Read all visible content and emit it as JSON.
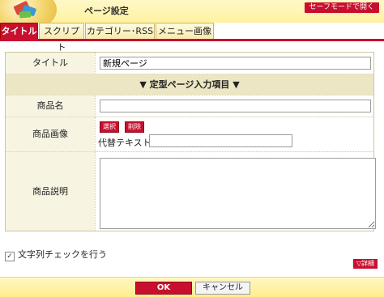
{
  "header": {
    "title": "ページ設定",
    "safe_mode_label": "セーフモードで開く"
  },
  "tabs": [
    {
      "label": "タイトル",
      "active": true
    },
    {
      "label": "スクリプト",
      "active": false
    },
    {
      "label": "カテゴリー･RSS",
      "active": false
    },
    {
      "label": "メニュー画像",
      "active": false
    }
  ],
  "form": {
    "title_label": "タイトル",
    "title_value": "新規ページ",
    "section_header": "▼ 定型ページ入力項目 ▼",
    "product_name_label": "商品名",
    "product_name_value": "",
    "product_image_label": "商品画像",
    "select_button": "選択",
    "delete_button": "削除",
    "alt_text_label": "代替テキスト:",
    "alt_text_value": "",
    "description_label": "商品説明",
    "description_value": ""
  },
  "options": {
    "string_check_label": "文字列チェックを行う",
    "string_check_checked": true,
    "detail_label": "▽詳細"
  },
  "footer": {
    "ok_label": "OK",
    "cancel_label": "キャンセル"
  },
  "colors": {
    "accent": "#c8102e",
    "header_bg": "#fff2a0",
    "form_bg": "#f7f4e2"
  }
}
